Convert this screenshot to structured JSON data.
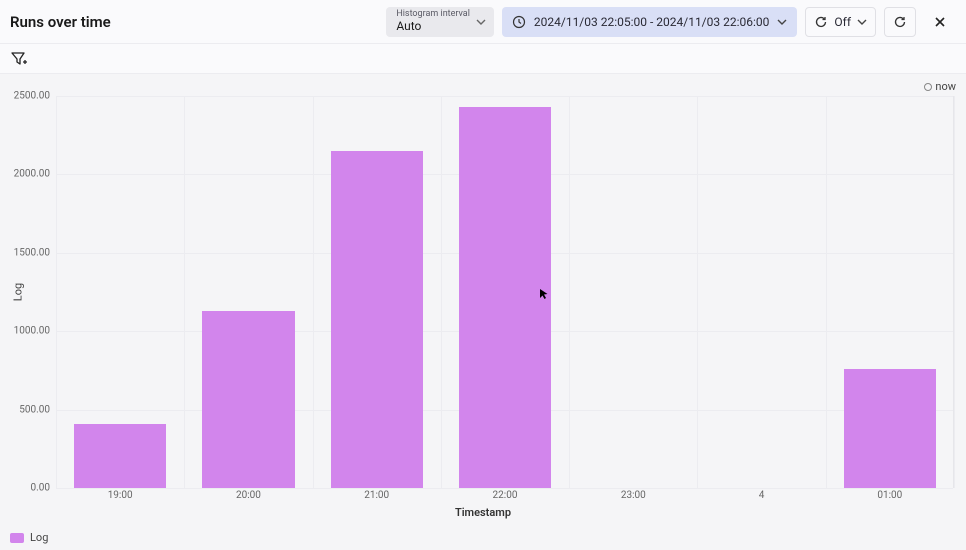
{
  "title": "Runs over time",
  "histogram": {
    "label": "Histogram interval",
    "value": "Auto"
  },
  "range": "2024/11/03 22:05:00 - 2024/11/03 22:06:00",
  "autorefresh": {
    "label": "Off"
  },
  "now_label": "now",
  "legend": {
    "series": "Log"
  },
  "xaxis_title": "Timestamp",
  "yaxis_title": "Log",
  "yticks": [
    "0.00",
    "500.00",
    "1000.00",
    "1500.00",
    "2000.00",
    "2500.00"
  ],
  "xticks": [
    "19:00",
    "20:00",
    "21:00",
    "22:00",
    "23:00",
    "4",
    "01:00"
  ],
  "chart_data": {
    "type": "bar",
    "categories": [
      "19:00",
      "20:00",
      "21:00",
      "22:00",
      "23:00",
      "4",
      "01:00"
    ],
    "values": [
      410,
      1130,
      2150,
      2430,
      0,
      0,
      760
    ],
    "title": "Runs over time",
    "xlabel": "Timestamp",
    "ylabel": "Log",
    "ylim": [
      0,
      2500
    ],
    "series_name": "Log",
    "bar_color": "#d285ec"
  }
}
